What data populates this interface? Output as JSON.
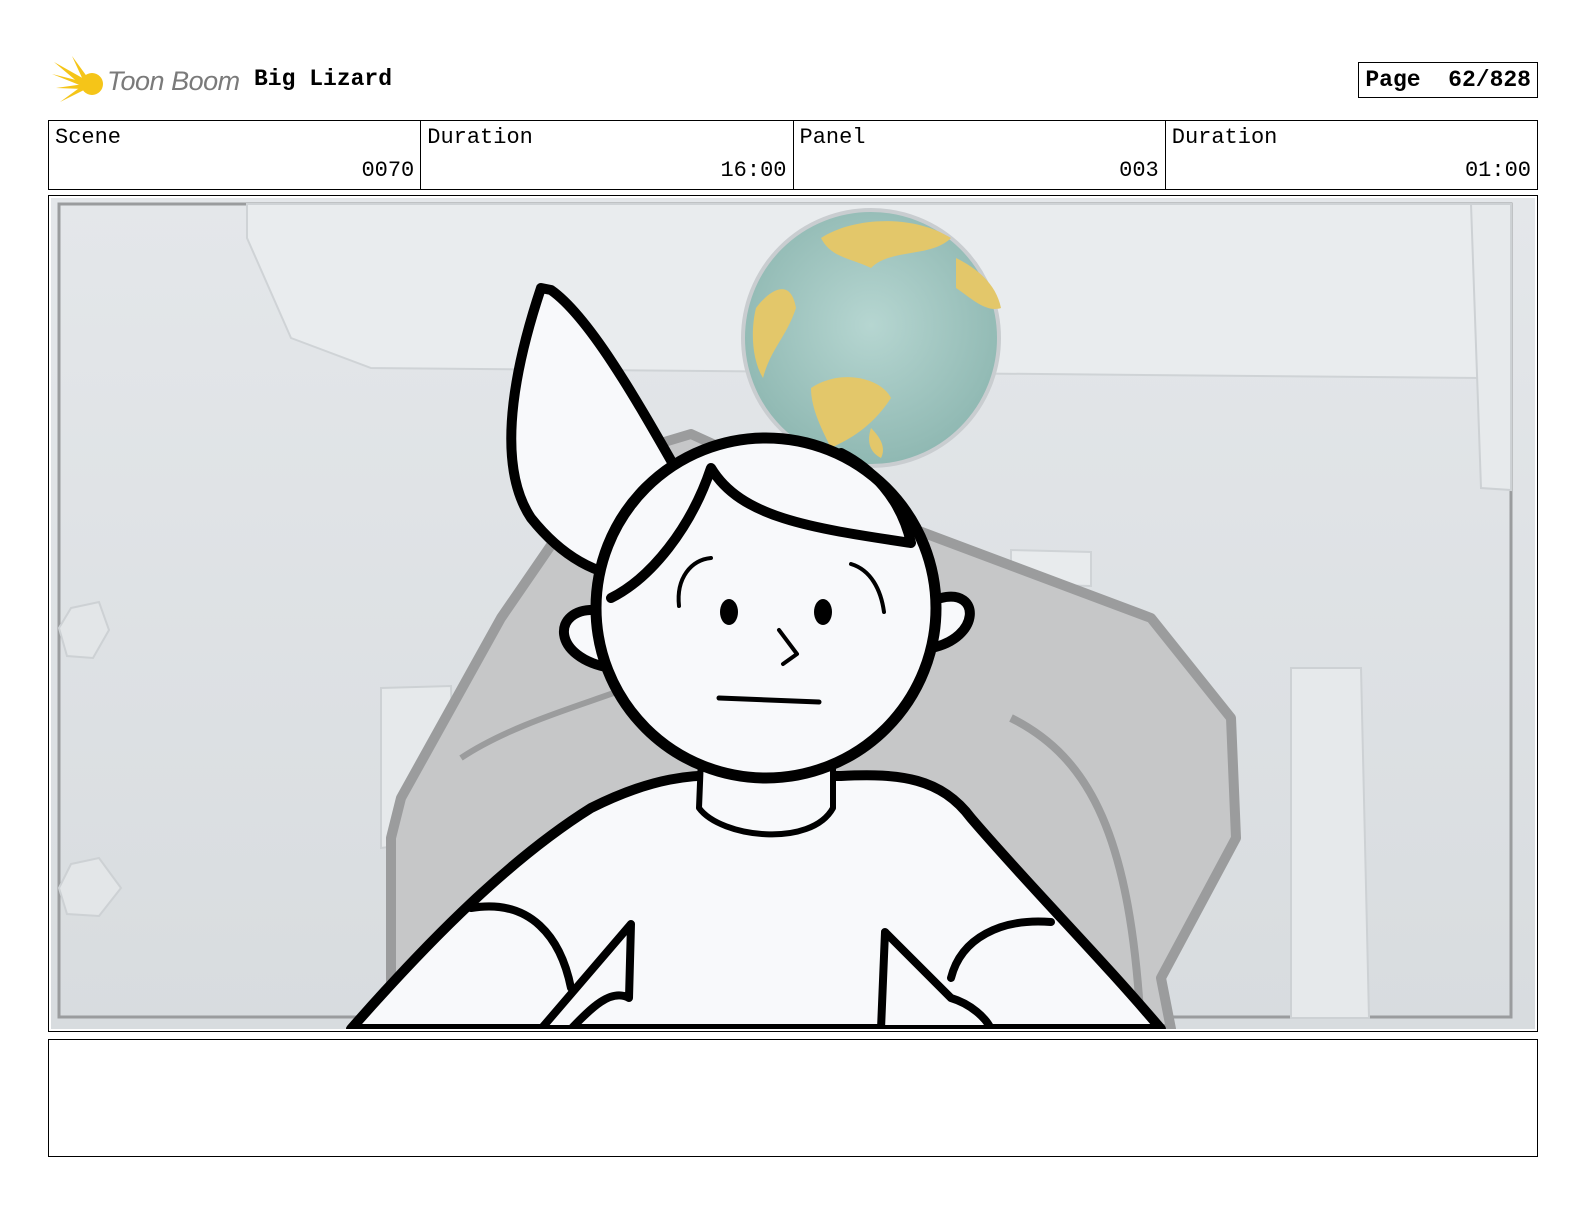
{
  "header": {
    "brand": "Toon Boom",
    "project_title": "Big Lizard",
    "page_label": "Page",
    "page_number": "62/828"
  },
  "info": {
    "scene_label": "Scene",
    "scene_value": "0070",
    "scene_duration_label": "Duration",
    "scene_duration_value": "16:00",
    "panel_label": "Panel",
    "panel_value": "003",
    "panel_duration_label": "Duration",
    "panel_duration_value": "01:00"
  },
  "colors": {
    "logo_yellow": "#f5c518",
    "background_grey": "#dfe2e5",
    "globe_teal": "#a9cdc8",
    "globe_land": "#e3c76a"
  },
  "notes": ""
}
